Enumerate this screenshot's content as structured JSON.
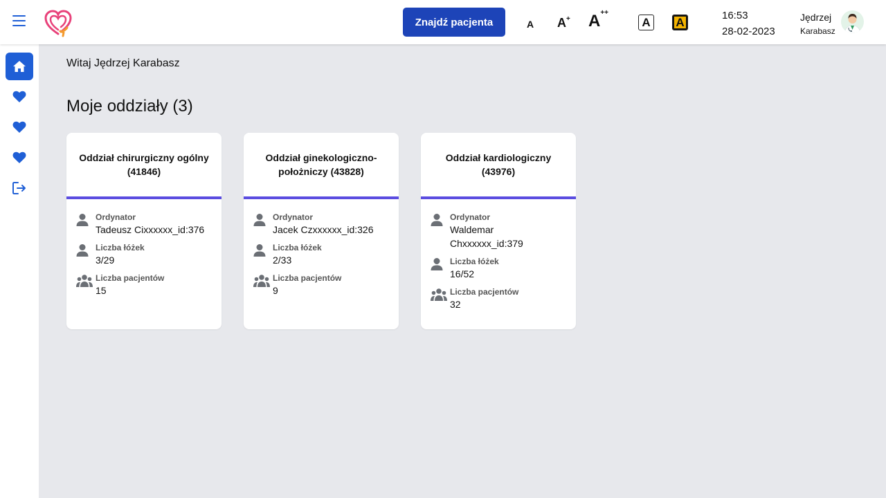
{
  "header": {
    "find_patient_label": "Znajdź pacjenta",
    "font_sizes": [
      "A",
      "A",
      "A"
    ],
    "font_sups": [
      "+",
      "++"
    ],
    "contrast_labels": [
      "A",
      "A"
    ],
    "time": "16:53",
    "date": "28-02-2023",
    "user_first": "Jędrzej",
    "user_last": "Karabasz"
  },
  "sidebar": {
    "items": [
      {
        "icon": "home-icon",
        "active": true
      },
      {
        "icon": "heart-icon"
      },
      {
        "icon": "heart-icon"
      },
      {
        "icon": "heart-icon"
      },
      {
        "icon": "logout-icon"
      }
    ]
  },
  "main": {
    "greeting": "Witaj Jędrzej Karabasz",
    "section_title": "Moje oddziały (3)",
    "labels": {
      "head": "Ordynator",
      "beds": "Liczba łóżek",
      "patients": "Liczba pacjentów"
    },
    "cards": [
      {
        "title": "Oddział chirurgiczny ogólny (41846)",
        "head": "Tadeusz Cixxxxxx_id:376",
        "beds": "3/29",
        "patients": "15"
      },
      {
        "title": "Oddział ginekologiczno-położniczy (43828)",
        "head": "Jacek Czxxxxxx_id:326",
        "beds": "2/33",
        "patients": "9"
      },
      {
        "title": "Oddział kardiologiczny (43976)",
        "head": "Waldemar Chxxxxxx_id:379",
        "beds": "16/52",
        "patients": "32"
      }
    ]
  },
  "colors": {
    "primary": "#1d44b8",
    "sidebar_accent": "#1f5fd6",
    "card_divider": "#5b4de0",
    "contrast_yellow": "#f4b400",
    "logo_pink": "#e8417a",
    "logo_orange": "#f39a2e"
  }
}
